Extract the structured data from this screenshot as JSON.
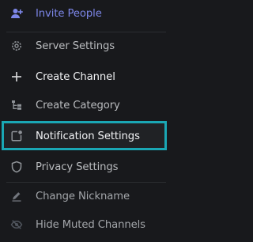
{
  "menu": {
    "items": [
      {
        "label": "Invite People",
        "icon": "person-add-icon"
      },
      {
        "label": "Server Settings",
        "icon": "gear-icon"
      },
      {
        "label": "Create Channel",
        "icon": "plus-icon"
      },
      {
        "label": "Create Category",
        "icon": "category-tree-icon"
      },
      {
        "label": "Notification Settings",
        "icon": "notification-icon"
      },
      {
        "label": "Privacy Settings",
        "icon": "shield-icon"
      },
      {
        "label": "Change Nickname",
        "icon": "pencil-icon"
      },
      {
        "label": "Hide Muted Channels",
        "icon": "eye-off-icon"
      }
    ],
    "highlighted_item": "Notification Settings"
  },
  "colors": {
    "background": "#18191c",
    "accent": "#7c86e8",
    "highlight_border": "#1aa7b4",
    "text": "#b9bbbe",
    "text_bright": "#f2f3f5"
  }
}
